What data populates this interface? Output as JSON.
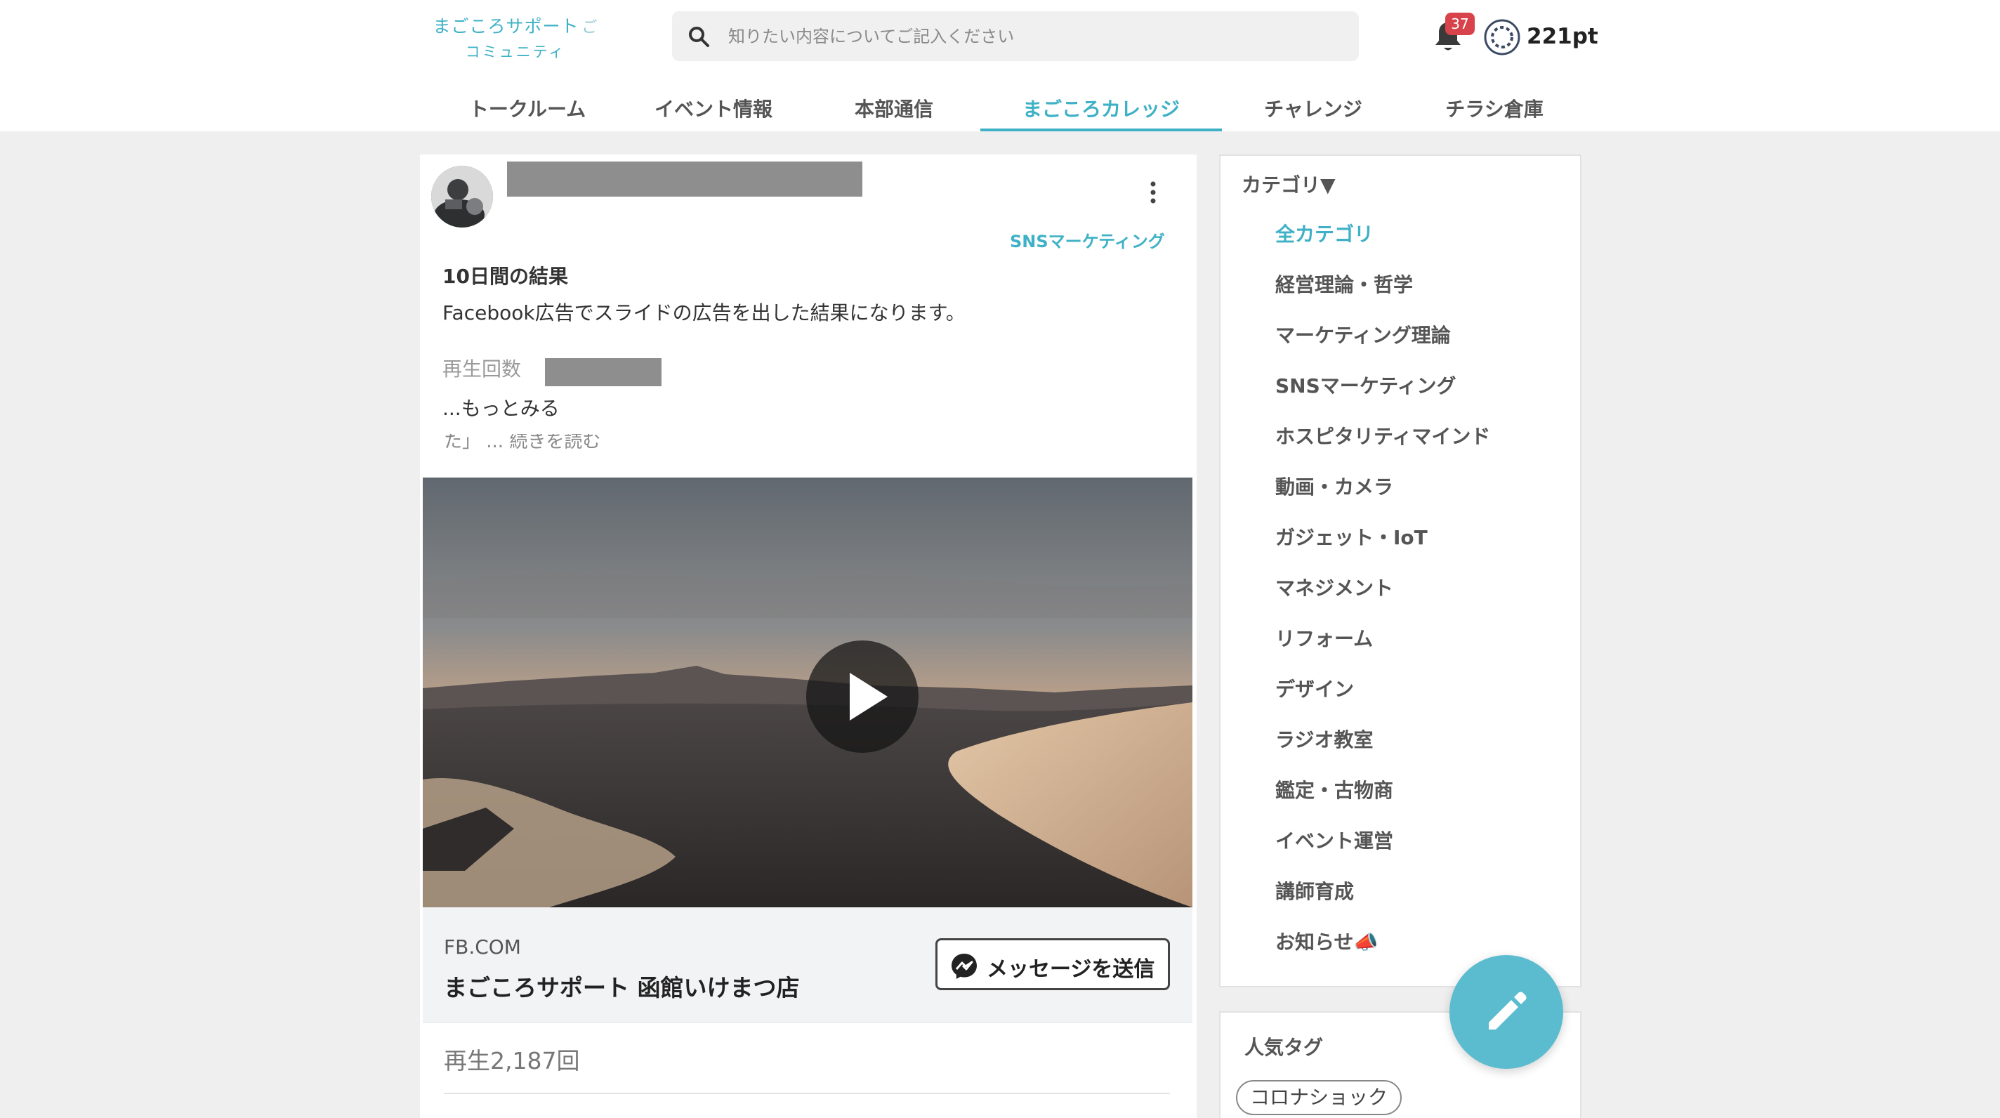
{
  "brand": {
    "line1": "まごころサポート",
    "line2": "コミュニティ",
    "color": "#3fb1c6"
  },
  "search": {
    "placeholder": "知りたい内容についてご記入ください"
  },
  "notifications": {
    "count": "37"
  },
  "points": {
    "label": "221pt"
  },
  "nav": {
    "items": [
      {
        "label": "トークルーム"
      },
      {
        "label": "イベント情報"
      },
      {
        "label": "本部通信"
      },
      {
        "label": "まごころカレッジ"
      },
      {
        "label": "チャレンジ"
      },
      {
        "label": "チラシ倉庫"
      }
    ],
    "active_index": 3
  },
  "post": {
    "category": "SNSマーケティング",
    "title": "10日間の結果",
    "body": "Facebook広告でスライドの広告を出した結果になります。",
    "plays_label": "再生回数",
    "more_label": "...もっとみる",
    "clipped_text": "た」 ... 続きを読む",
    "ad": {
      "domain": "FB.COM",
      "page_name": "まごころサポート 函館いけまつ店",
      "button_label": "メッセージを送信"
    },
    "view_count": "再生2,187回"
  },
  "sidebar": {
    "header": "カテゴリ▼",
    "items": [
      {
        "label": "全カテゴリ"
      },
      {
        "label": "経営理論・哲学"
      },
      {
        "label": "マーケティング理論"
      },
      {
        "label": "SNSマーケティング"
      },
      {
        "label": "ホスピタリティマインド"
      },
      {
        "label": "動画・カメラ"
      },
      {
        "label": "ガジェット・IoT"
      },
      {
        "label": "マネジメント"
      },
      {
        "label": "リフォーム"
      },
      {
        "label": "デザイン"
      },
      {
        "label": "ラジオ教室"
      },
      {
        "label": "鑑定・古物商"
      },
      {
        "label": "イベント運営"
      },
      {
        "label": "講師育成"
      },
      {
        "label": "お知らせ📣"
      }
    ],
    "active_index": 0
  },
  "tags": {
    "header": "人気タグ",
    "items": [
      {
        "label": "コロナショック"
      }
    ]
  },
  "icons": {
    "search": "search-icon",
    "bell": "bell-icon",
    "points": "points-icon",
    "kebab": "kebab-menu-icon",
    "play": "play-icon",
    "messenger": "messenger-icon",
    "fab": "pencil-icon"
  },
  "colors": {
    "accent": "#3fb1c6",
    "badge": "#d8424a",
    "fab": "#5bbccf",
    "page_bg": "#efefef"
  }
}
